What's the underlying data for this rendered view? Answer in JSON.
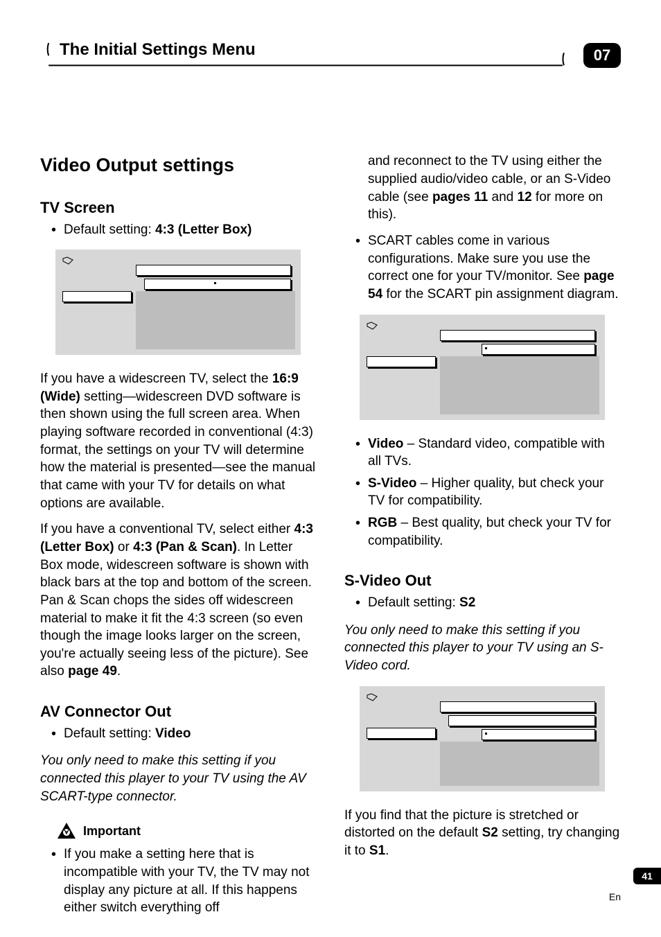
{
  "header": {
    "title": "The Initial Settings Menu",
    "chapter": "07"
  },
  "left": {
    "h1": "Video Output settings",
    "tvscreen": {
      "heading": "TV Screen",
      "bullet_prefix": "Default setting: ",
      "bullet_value": "4:3 (Letter Box)",
      "p1a": "If you have a widescreen TV, select the ",
      "p1b": "16:9 (Wide)",
      "p1c": " setting—widescreen DVD software is then shown using the full screen area. When playing software recorded in conventional (4:3) format, the settings on your TV will determine how the material is presented—see the manual that came with your TV for details on what options are available.",
      "p2a": "If you have a conventional TV, select either ",
      "p2b": "4:3 (Letter Box)",
      "p2c": " or ",
      "p2d": "4:3 (Pan & Scan)",
      "p2e": ". In Letter Box mode, widescreen software is shown with black bars at the top and bottom of the screen. Pan & Scan chops the sides off widescreen material to make it fit the 4:3 screen (so even though the image looks larger on the screen, you're actually seeing less of the picture). See also ",
      "p2f": "page 49",
      "p2g": "."
    },
    "avconn": {
      "heading": "AV Connector Out",
      "bullet_prefix": "Default setting: ",
      "bullet_value": "Video",
      "italic": "You only need to make this setting if you connected this player to your TV using the AV SCART-type connector.",
      "important_label": "Important",
      "imp_bullet": "If you make a setting here that is incompatible with your TV, the TV may not display any picture at all. If this happens either switch everything off"
    }
  },
  "right": {
    "cont1a": "and reconnect to the TV using either the supplied audio/video cable, or an S-Video cable (see ",
    "cont1b": "pages 11",
    "cont1c": " and ",
    "cont1d": "12",
    "cont1e": " for more on this).",
    "scart1": "SCART cables come in various configurations. Make sure you use the correct one for your TV/monitor. See ",
    "scart2": "page 54",
    "scart3": " for the SCART pin assignment diagram.",
    "vid_b": "Video",
    "vid_t": " – Standard video, compatible with all TVs.",
    "svid_b": "S-Video",
    "svid_t": " – Higher quality, but check your TV for compatibility.",
    "rgb_b": "RGB",
    "rgb_t": " – Best quality, but check your TV for compatibility.",
    "svideoout": {
      "heading": "S-Video Out",
      "bullet_prefix": "Default setting: ",
      "bullet_value": "S2",
      "italic": "You only need to make this setting if you connected this player to your TV using an S-Video cord.",
      "p1a": "If you find that the picture is stretched or distorted on the default ",
      "p1b": "S2",
      "p1c": " setting, try changing it to ",
      "p1d": "S1",
      "p1e": "."
    }
  },
  "footer": {
    "page": "41",
    "lang": "En"
  }
}
